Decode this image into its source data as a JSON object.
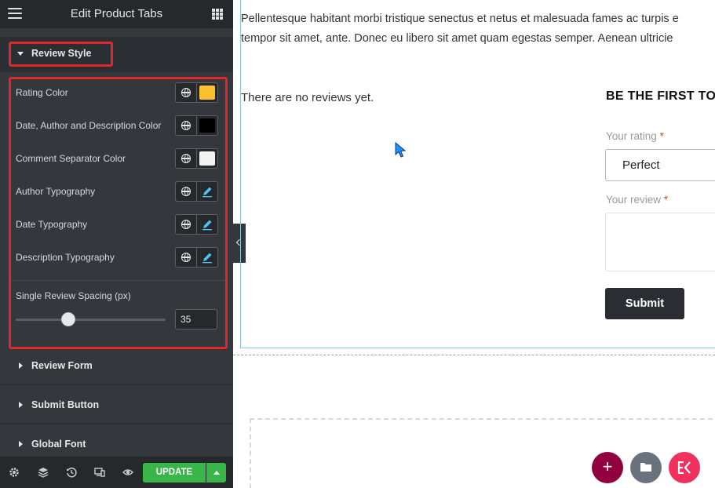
{
  "panel": {
    "title": "Edit Product Tabs",
    "sections": {
      "review_style": "Review Style",
      "review_form": "Review Form",
      "submit_button": "Submit Button",
      "global_font": "Global Font"
    },
    "controls": [
      {
        "label": "Rating Color",
        "kind": "color",
        "color": "#fbc02d"
      },
      {
        "label": "Date, Author and Description Color",
        "kind": "color",
        "color": "#000000"
      },
      {
        "label": "Comment Separator Color",
        "kind": "color",
        "color": "#f2f2f2"
      },
      {
        "label": "Author Typography",
        "kind": "typography"
      },
      {
        "label": "Date Typography",
        "kind": "typography"
      },
      {
        "label": "Description Typography",
        "kind": "typography"
      }
    ],
    "spacing": {
      "label": "Single Review Spacing (px)",
      "value": "35"
    },
    "footer": {
      "icons": [
        "settings-icon",
        "layers-icon",
        "history-icon",
        "responsive-icon",
        "preview-eye-icon"
      ],
      "update_label": "UPDATE"
    }
  },
  "preview": {
    "description_line1": "Pellentesque habitant morbi tristique senectus et netus et malesuada fames ac turpis e",
    "description_line2": "tempor sit amet, ante. Donec eu libero sit amet quam egestas semper. Aenean ultricie",
    "no_reviews": "There are no reviews yet.",
    "heading": "BE THE FIRST TO",
    "rating_label": "Your rating",
    "rating_value": "Perfect",
    "review_label": "Your review",
    "required_mark": "*",
    "submit_label": "Submit"
  },
  "colors": {
    "accent_red": "#e3262e",
    "update_green": "#39b54a",
    "fab_add": "#93003f",
    "fab_folder": "#69727d",
    "fab_ek": "#f0315e"
  }
}
